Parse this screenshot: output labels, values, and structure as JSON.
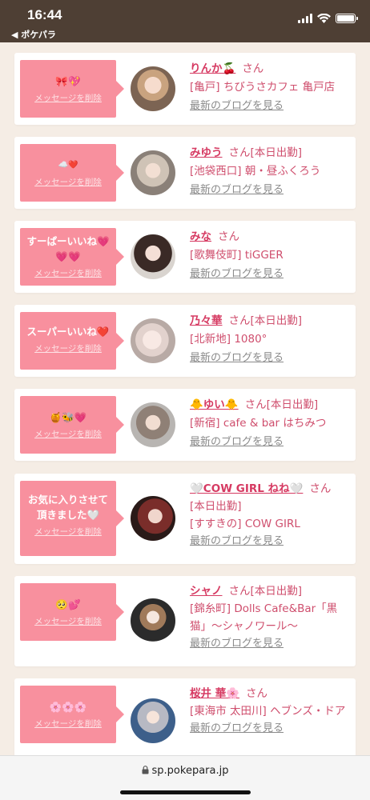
{
  "status_bar": {
    "time": "16:44",
    "back_label": "◀ ポケパラ"
  },
  "colors": {
    "accent_pink": "#f8909e",
    "name_pink": "#d63a62",
    "status_bar_bg": "#4e3f34"
  },
  "delete_label": "メッセージを削除",
  "san_label": "さん",
  "blog_label": "最新のブログを見る",
  "cards": [
    {
      "message": "🎀💖",
      "name": "りんか🍒",
      "san_suffix": "",
      "shop": "[亀戸] ちびうさカフェ 亀戸店"
    },
    {
      "message": "☁️❤️",
      "name": "みゆう",
      "san_suffix": "[本日出勤]",
      "shop": "[池袋西口] 朝・昼ふくろう"
    },
    {
      "message": "すーぱーいいね💗\n💗💗",
      "name": "みな",
      "san_suffix": "",
      "shop": "[歌舞伎町] tiGGER"
    },
    {
      "message": "スーパーいいね❤️",
      "name": "乃々華",
      "san_suffix": "[本日出勤]",
      "shop": "[北新地] 1080°"
    },
    {
      "message": "🍯🐝💗",
      "name": "🐥ゆい🐥",
      "san_suffix": "[本日出勤]",
      "shop": "[新宿] cafe & bar はちみつ"
    },
    {
      "message": "お気に入りさせて\n頂きました🤍",
      "name": "🤍COW GIRL ねね🤍",
      "san_suffix": "[本日出勤]",
      "shop": "[すすきの] COW GIRL"
    },
    {
      "message": "🥺💕",
      "name": "シャノ",
      "san_suffix": "[本日出勤]",
      "shop": "[錦糸町] Dolls Cafe&Bar「黒猫」〜シャノワール〜"
    },
    {
      "message": "🌸🌸🌸",
      "name": "桜井 華🌸",
      "san_suffix": "",
      "shop": "[東海市 太田川] ヘブンズ・ドア"
    }
  ],
  "url_bar": {
    "url": "sp.pokepara.jp"
  }
}
